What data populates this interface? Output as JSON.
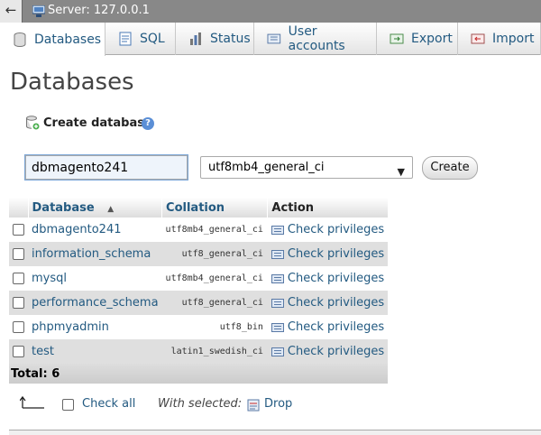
{
  "server": {
    "label": "Server: 127.0.0.1",
    "back_label": "←"
  },
  "tabs": [
    {
      "label": "Databases",
      "icon": "database-icon",
      "active": true
    },
    {
      "label": "SQL",
      "icon": "sql-icon"
    },
    {
      "label": "Status",
      "icon": "status-icon"
    },
    {
      "label": "User accounts",
      "icon": "user-accounts-icon"
    },
    {
      "label": "Export",
      "icon": "export-icon"
    },
    {
      "label": "Import",
      "icon": "import-icon"
    }
  ],
  "page_title": "Databases",
  "create_database": {
    "label": "Create database",
    "help": "?",
    "name_value": "dbmagento241",
    "collation_value": "utf8mb4_general_ci",
    "button_label": "Create"
  },
  "table": {
    "headers": {
      "database": "Database",
      "collation": "Collation",
      "action": "Action"
    },
    "rows": [
      {
        "name": "dbmagento241",
        "collation": "utf8mb4_general_ci",
        "action": "Check privileges"
      },
      {
        "name": "information_schema",
        "collation": "utf8_general_ci",
        "action": "Check privileges"
      },
      {
        "name": "mysql",
        "collation": "utf8mb4_general_ci",
        "action": "Check privileges"
      },
      {
        "name": "performance_schema",
        "collation": "utf8_general_ci",
        "action": "Check privileges"
      },
      {
        "name": "phpmyadmin",
        "collation": "utf8_bin",
        "action": "Check privileges"
      },
      {
        "name": "test",
        "collation": "latin1_swedish_ci",
        "action": "Check privileges"
      }
    ],
    "total_label": "Total: 6"
  },
  "bulk": {
    "check_all": "Check all",
    "with_selected": "With selected:",
    "drop": "Drop"
  },
  "colors": {
    "link": "#235a81",
    "topbar": "#888888",
    "row_alt": "#dfdfdf"
  }
}
